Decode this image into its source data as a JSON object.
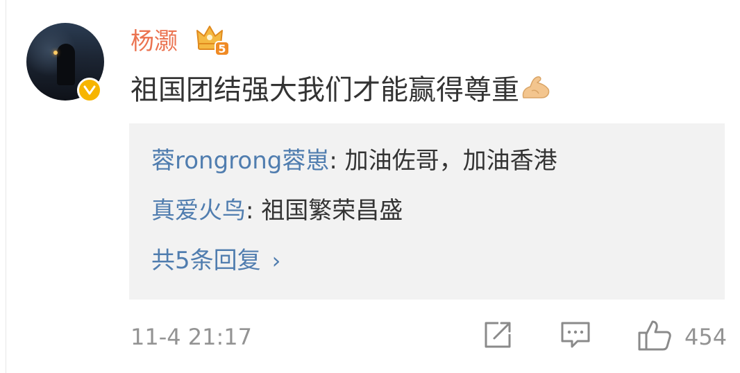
{
  "post": {
    "username": "杨灏",
    "vip_badge_icon": "crown-vip-level-badge",
    "vip_level": "5",
    "text": "祖国团结强大我们才能赢得尊重",
    "emoji_icon": "flexed-biceps-emoji"
  },
  "replies": [
    {
      "author": "蓉rongrong蓉崽",
      "separator": ":",
      "text": " 加油佐哥，加油香港"
    },
    {
      "author": "真爱火鸟",
      "separator": ":",
      "text": " 祖国繁荣昌盛"
    }
  ],
  "more_replies": {
    "label": "共5条回复",
    "chevron": "›"
  },
  "footer": {
    "timestamp": "11-4 21:17",
    "share_icon": "share-arrow-icon",
    "comment_icon": "comment-icon",
    "like_icon": "thumbs-up-icon",
    "like_count": "454"
  },
  "colors": {
    "username": "#eb7350",
    "link": "#507daf",
    "body_text": "#333333",
    "meta_text": "#939393",
    "reply_bg": "#f2f2f2",
    "verify_badge": "#f7b500"
  }
}
